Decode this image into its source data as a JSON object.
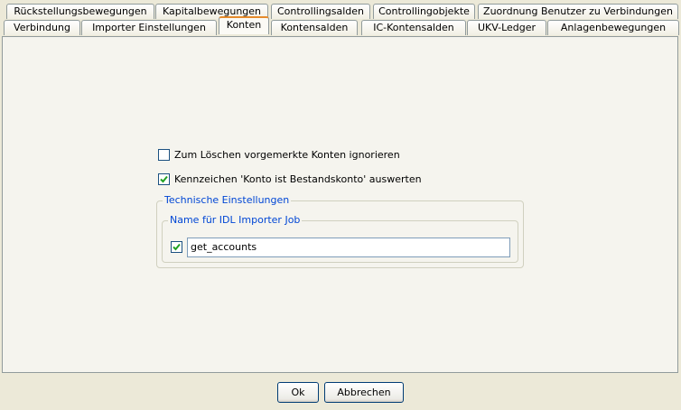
{
  "tabs_row1": [
    {
      "label": "Rückstellungsbewegungen"
    },
    {
      "label": "Kapitalbewegungen"
    },
    {
      "label": "Controllingsalden"
    },
    {
      "label": "Controllingobjekte"
    },
    {
      "label": "Zuordnung Benutzer zu Verbindungen"
    }
  ],
  "tabs_row2": [
    {
      "label": "Verbindung"
    },
    {
      "label": "Importer Einstellungen"
    },
    {
      "label": "Konten",
      "active": true
    },
    {
      "label": "Kontensalden"
    },
    {
      "label": "IC-Kontensalden"
    },
    {
      "label": "UKV-Ledger"
    },
    {
      "label": "Anlagenbewegungen"
    }
  ],
  "options": {
    "ignore_marked": {
      "label": "Zum Löschen vorgemerkte Konten ignorieren",
      "checked": false
    },
    "evaluate_flag": {
      "label": "Kennzeichen 'Konto ist Bestandskonto' auswerten",
      "checked": true
    }
  },
  "technical": {
    "title": "Technische Einstellungen",
    "job_group_title": "Name für IDL Importer Job",
    "job_enabled": true,
    "job_name": "get_accounts"
  },
  "buttons": {
    "ok": "Ok",
    "cancel": "Abbrechen"
  },
  "colors": {
    "active_tab_accent": "#e68b2c",
    "group_title": "#0046d5",
    "checkmark": "#21a121"
  }
}
